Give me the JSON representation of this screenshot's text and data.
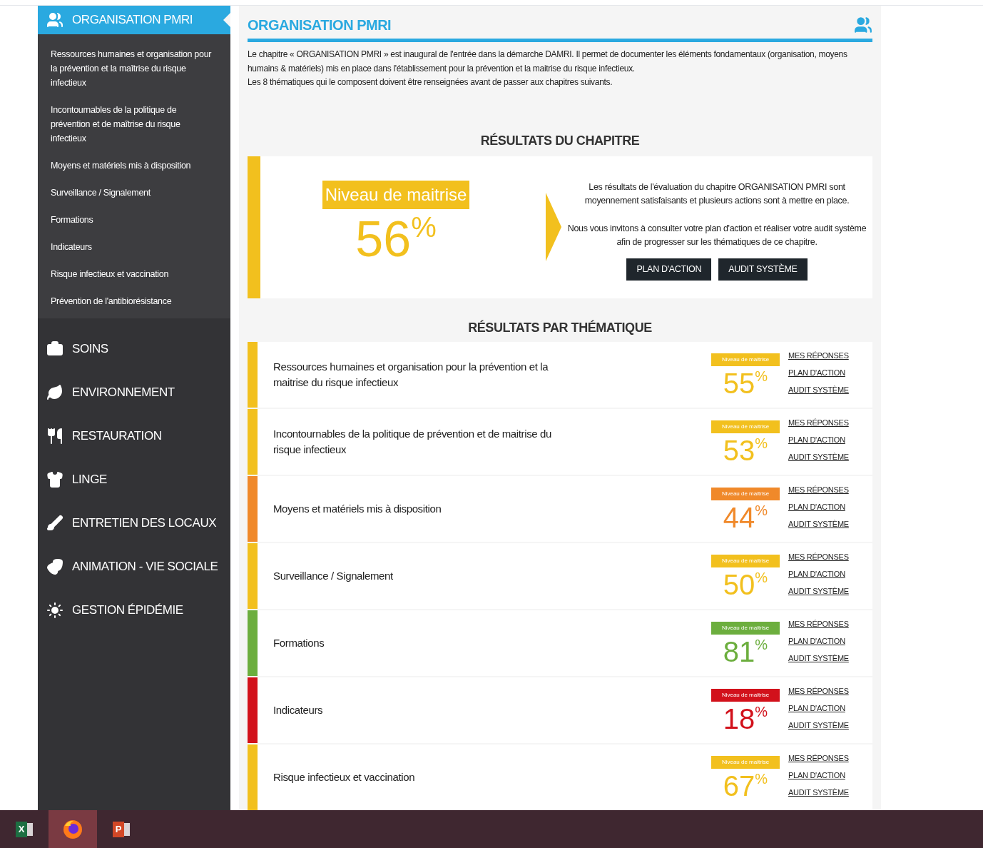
{
  "sidebar": {
    "sections": [
      {
        "title": "ORGANISATION PMRI",
        "kind": "users",
        "selected": true,
        "children": [
          "Ressources humaines et organisation pour la prévention et la maîtrise du risque infectieux",
          "Incontournables de la politique de prévention et de maîtrise du risque infectieux",
          "Moyens et matériels mis à disposition",
          "Surveillance / Signalement",
          "Formations",
          "Indicateurs",
          "Risque infectieux et vaccination",
          "Prévention de l'antibiorésistance"
        ]
      },
      {
        "title": "SOINS",
        "kind": "medkit",
        "selected": false
      },
      {
        "title": "ENVIRONNEMENT",
        "kind": "leaf",
        "selected": false
      },
      {
        "title": "RESTAURATION",
        "kind": "utensils",
        "selected": false
      },
      {
        "title": "LINGE",
        "kind": "shirt",
        "selected": false
      },
      {
        "title": "ENTRETIEN DES LOCAUX",
        "kind": "cleaning",
        "selected": false
      },
      {
        "title": "ANIMATION - VIE SOCIALE",
        "kind": "masks",
        "selected": false
      },
      {
        "title": "GESTION ÉPIDÉMIE",
        "kind": "virus",
        "selected": false
      }
    ]
  },
  "main": {
    "title": "ORGANISATION PMRI",
    "description": [
      "Le chapitre « ORGANISATION PMRI » est inaugural de l'entrée dans la démarche DAMRI. Il permet de documenter les éléments fondamentaux (organisation, moyens humains & matériels) mis en place dans l'établissement pour la prévention et la maitrise du risque infectieux.",
      "Les 8 thématiques qui le composent doivent être renseignées avant de passer aux chapitres suivants."
    ],
    "chapter_results": {
      "heading": "RÉSULTATS DU CHAPITRE",
      "badge": "Niveau de maitrise",
      "score": "56",
      "unit": "%",
      "color": "#f2c01e",
      "messages": [
        "Les résultats de l'évaluation du chapitre ORGANISATION PMRI sont moyennement satisfaisants et plusieurs actions sont à mettre en place.",
        "Nous vous invitons à consulter votre plan d'action et réaliser votre audit système afin de progresser sur les thématiques de ce chapitre."
      ],
      "buttons": [
        "PLAN D'ACTION",
        "AUDIT SYSTÈME"
      ]
    },
    "themes": {
      "heading": "RÉSULTATS PAR THÉMATIQUE",
      "rows": [
        {
          "label": "Ressources humaines et organisation pour la prévention et la maitrise du risque infectieux",
          "badge": "Niveau de maitrise",
          "score": "55",
          "unit": "%",
          "color": "#f2c01e",
          "links": [
            "MES RÉPONSES",
            "PLAN D'ACTION",
            "AUDIT SYSTÈME"
          ]
        },
        {
          "label": "Incontournables de la politique de prévention et de maitrise du risque infectieux",
          "badge": "Niveau de maitrise",
          "score": "53",
          "unit": "%",
          "color": "#f2c01e",
          "links": [
            "MES RÉPONSES",
            "PLAN D'ACTION",
            "AUDIT SYSTÈME"
          ]
        },
        {
          "label": "Moyens et matériels mis à disposition",
          "badge": "Niveau de maitrise",
          "score": "44",
          "unit": "%",
          "color": "#f0892a",
          "links": [
            "MES RÉPONSES",
            "PLAN D'ACTION",
            "AUDIT SYSTÈME"
          ]
        },
        {
          "label": "Surveillance / Signalement",
          "badge": "Niveau de maitrise",
          "score": "50",
          "unit": "%",
          "color": "#f2c01e",
          "links": [
            "MES RÉPONSES",
            "PLAN D'ACTION",
            "AUDIT SYSTÈME"
          ]
        },
        {
          "label": "Formations",
          "badge": "Niveau de maitrise",
          "score": "81",
          "unit": "%",
          "color": "#6cae3e",
          "links": [
            "MES RÉPONSES",
            "PLAN D'ACTION",
            "AUDIT SYSTÈME"
          ]
        },
        {
          "label": "Indicateurs",
          "badge": "Niveau de maitrise",
          "score": "18",
          "unit": "%",
          "color": "#d2111b",
          "links": [
            "MES RÉPONSES",
            "PLAN D'ACTION",
            "AUDIT SYSTÈME"
          ]
        },
        {
          "label": "Risque infectieux et vaccination",
          "badge": "Niveau de maitrise",
          "score": "67",
          "unit": "%",
          "color": "#f2c01e",
          "links": [
            "MES RÉPONSES",
            "PLAN D'ACTION",
            "AUDIT SYSTÈME"
          ]
        }
      ]
    }
  },
  "taskbar": [
    {
      "kind": "excel",
      "letter": "X",
      "selected": false
    },
    {
      "kind": "firefox",
      "selected": true
    },
    {
      "kind": "powerpoint",
      "letter": "P",
      "selected": false
    }
  ]
}
